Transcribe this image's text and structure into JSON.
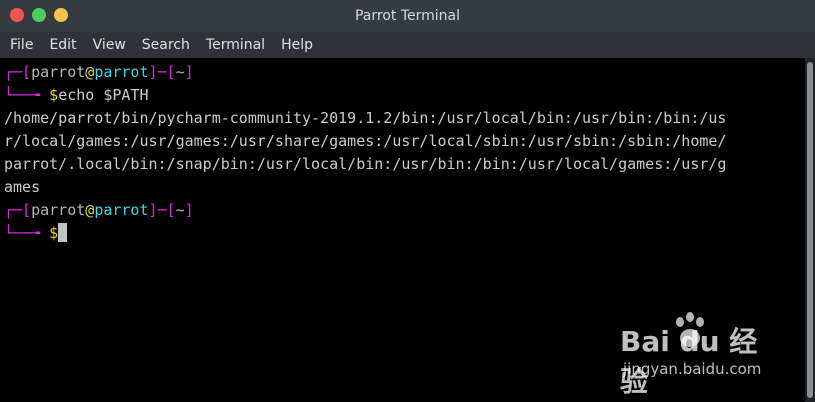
{
  "window": {
    "title": "Parrot Terminal"
  },
  "menu": {
    "items": [
      "File",
      "Edit",
      "View",
      "Search",
      "Terminal",
      "Help"
    ]
  },
  "terminal": {
    "prompt": {
      "box_top": "┌─[",
      "user": "parrot",
      "at": "@",
      "host": "parrot",
      "sep": "]─[",
      "dir": "~",
      "close": "]",
      "box_bottom": "└──╼ ",
      "dollar": "$"
    },
    "command": "echo $PATH",
    "output_lines": [
      "/home/parrot/bin/pycharm-community-2019.1.2/bin:/usr/local/bin:/usr/bin:/bin:/us",
      "r/local/games:/usr/games:/usr/share/games:/usr/local/sbin:/usr/sbin:/sbin:/home/",
      "parrot/.local/bin:/snap/bin:/usr/local/bin:/usr/bin:/bin:/usr/local/games:/usr/g",
      "ames"
    ]
  },
  "watermark": {
    "logo": "Bai du 经验",
    "url": "jingyan.baidu.com"
  },
  "colors": {
    "titlebar": "#363b40",
    "menubar": "#2f3337",
    "terminal_bg": "#000000",
    "prompt_bracket": "#d52cd6",
    "prompt_host": "#30d9e0",
    "prompt_at": "#e4d63e"
  }
}
